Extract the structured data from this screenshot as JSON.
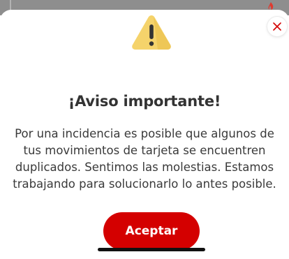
{
  "modal": {
    "title": "¡Aviso importante!",
    "message": "Por una incidencia es posible que algunos de tus movimientos de tarjeta se encuentren duplicados. Sentimos las molestias. Estamos trabajando para solucionarlo lo antes posible.",
    "accept_label": "Aceptar"
  },
  "icons": {
    "warning": "warning-icon",
    "close": "close-icon",
    "brand": "santander-flame-icon"
  },
  "colors": {
    "accent": "#d40000",
    "warning_fill": "#f5d36b",
    "text": "#333333"
  }
}
